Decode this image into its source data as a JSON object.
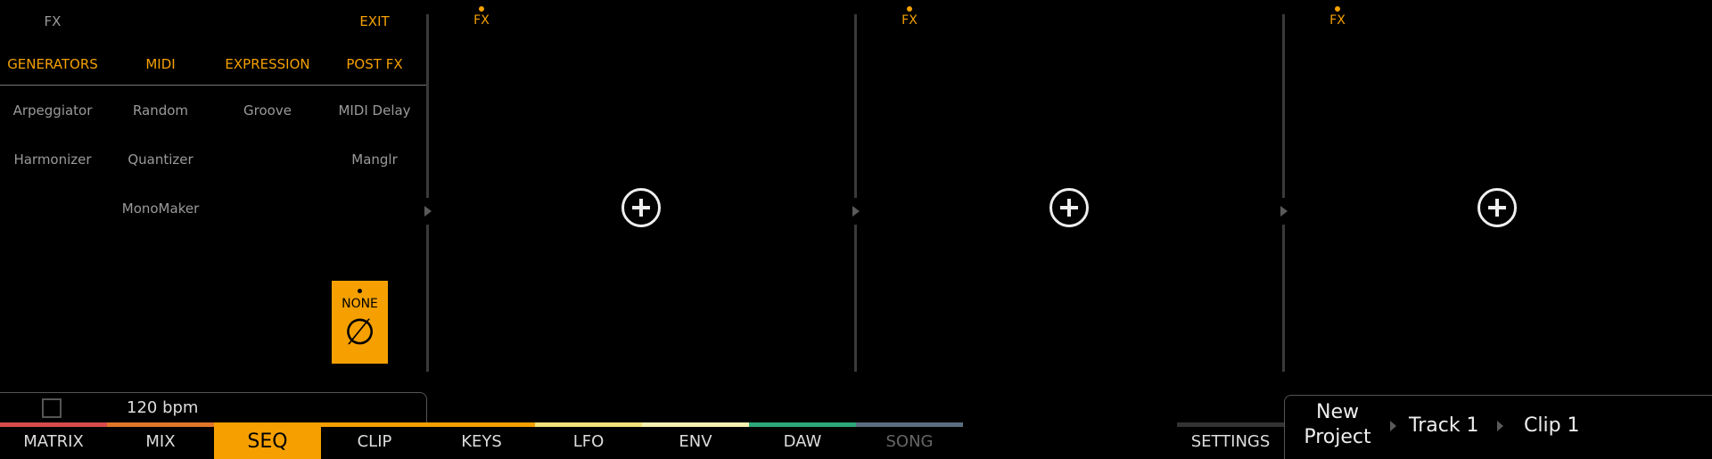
{
  "panel": {
    "fx_label": "FX",
    "exit_label": "EXIT",
    "categories": [
      "GENERATORS",
      "MIDI",
      "EXPRESSION",
      "POST FX"
    ],
    "devices": {
      "arpeggiator": "Arpeggiator",
      "random": "Random",
      "groove": "Groove",
      "midi_delay": "MIDI Delay",
      "harmonizer": "Harmonizer",
      "quantizer": "Quantizer",
      "manglr": "Manglr",
      "monomaker": "MonoMaker"
    },
    "none_label": "NONE",
    "none_symbol": "∅",
    "bpm": "120 bpm"
  },
  "slots": [
    {
      "fx_label": "FX"
    },
    {
      "fx_label": "FX"
    },
    {
      "fx_label": "FX"
    }
  ],
  "tabs": [
    {
      "label": "MATRIX",
      "color": "#d94b4b"
    },
    {
      "label": "MIX",
      "color": "#e0762a"
    },
    {
      "label": "SEQ",
      "color": "#f5a000",
      "active": true
    },
    {
      "label": "CLIP",
      "color": "#f5a000"
    },
    {
      "label": "KEYS",
      "color": "#f5a000"
    },
    {
      "label": "LFO",
      "color": "#f3e37a"
    },
    {
      "label": "ENV",
      "color": "#f7f0b0"
    },
    {
      "label": "DAW",
      "color": "#2ea87a"
    },
    {
      "label": "SONG",
      "color": "#5b6d80",
      "disabled": true
    }
  ],
  "settings_label": "SETTINGS",
  "breadcrumb": {
    "project": "New Project",
    "project_line1": "New",
    "project_line2": "Project",
    "track": "Track 1",
    "clip": "Clip 1"
  },
  "colors": {
    "accent": "#f5a000",
    "background": "#000000",
    "text_gray": "#9a9a9a"
  }
}
